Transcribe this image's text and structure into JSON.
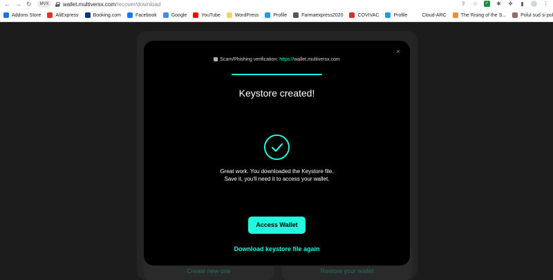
{
  "browser": {
    "site_chip": "MVX",
    "url_host": "wallet.multiversx.com",
    "url_path": "/recover/download",
    "bookmarks": [
      {
        "label": "Addons Store",
        "color": "#1a73e8"
      },
      {
        "label": "AliExpress",
        "color": "#e43225"
      },
      {
        "label": "Booking.com",
        "color": "#003580"
      },
      {
        "label": "Facebook",
        "color": "#1877f2"
      },
      {
        "label": "Google",
        "color": "#4285f4"
      },
      {
        "label": "YouTube",
        "color": "#ff0000"
      },
      {
        "label": "WordPress",
        "color": "#f6d365"
      },
      {
        "label": "Profile",
        "color": "#1d9bf0"
      },
      {
        "label": "Farmaexpress2020",
        "color": "#555555"
      },
      {
        "label": "COVIVAC",
        "color": "#d93025"
      },
      {
        "label": "Profile",
        "color": "#1d9bf0"
      },
      {
        "label": "Cloud-ARC",
        "color": "#ffffff"
      },
      {
        "label": "The Rising of the S...",
        "color": "#f28b30"
      },
      {
        "label": "Polul sud si polul n...",
        "color": "#8d6e63"
      }
    ]
  },
  "background": {
    "create_label": "Create new one",
    "restore_label": "Restore your wallet"
  },
  "modal": {
    "close_glyph": "×",
    "scam_prefix": "Scam/Phishing verification: ",
    "scam_https": "https://",
    "scam_domain": "wallet.multiversx.com",
    "title": "Keystore created!",
    "message_line1": "Great work. You downloaded the Keystore file.",
    "message_line2": "Save it, you'll need it to access your wallet.",
    "primary_button": "Access Wallet",
    "secondary_link": "Download keystore file again"
  },
  "colors": {
    "accent": "#23f7dd",
    "modal_bg": "#000000"
  }
}
